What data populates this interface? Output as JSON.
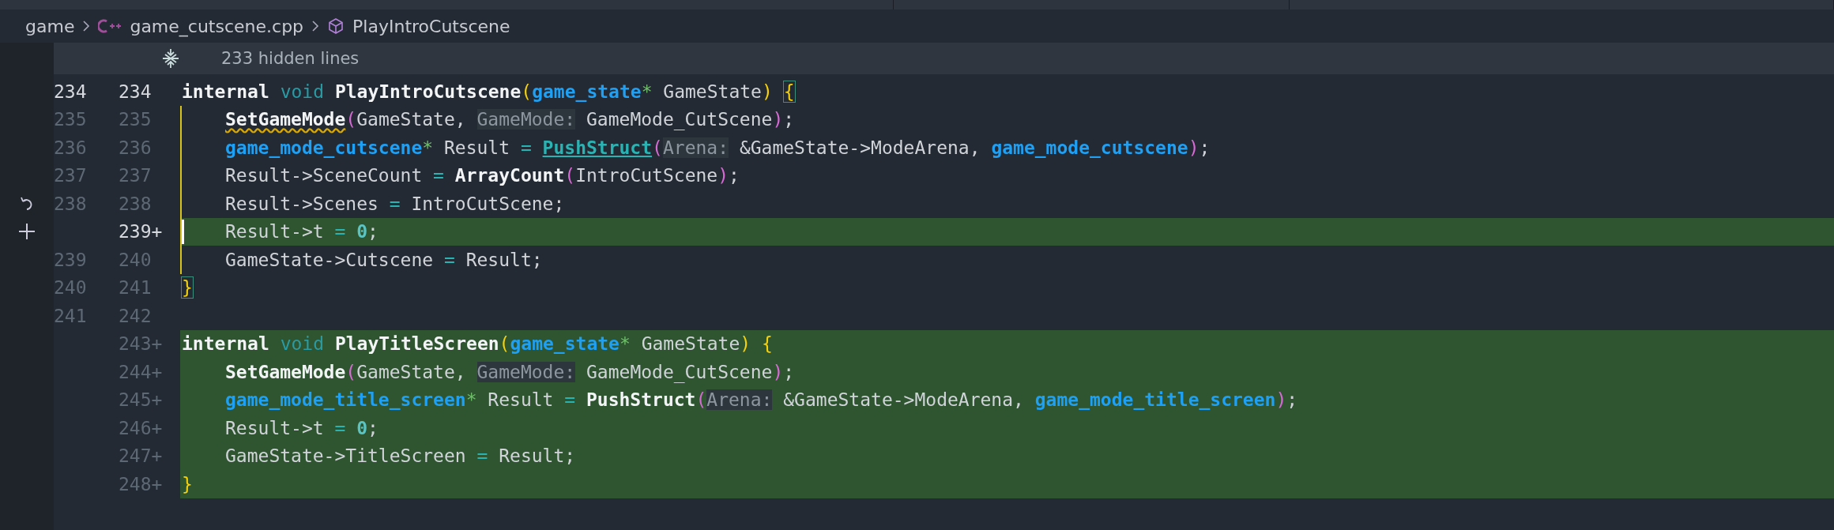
{
  "breadcrumb": [
    {
      "kind": "folder",
      "label": "game"
    },
    {
      "kind": "cpp",
      "label": "game_cutscene.cpp"
    },
    {
      "kind": "symbol",
      "label": "PlayIntroCutscene"
    }
  ],
  "folded": {
    "label": "233 hidden lines"
  },
  "lines": [
    {
      "old": "234",
      "new": "234",
      "added": false,
      "current": true,
      "scope": false,
      "cursor": false,
      "indented": false,
      "tokens": [
        {
          "kind": "kw",
          "t": "internal "
        },
        {
          "kind": "type",
          "t": "void "
        },
        {
          "kind": "fn",
          "t": "PlayIntroCutscene"
        },
        {
          "kind": "p1",
          "t": "("
        },
        {
          "kind": "tname",
          "t": "game_state"
        },
        {
          "kind": "star",
          "t": "*"
        },
        {
          "kind": "text",
          "t": " GameState"
        },
        {
          "kind": "p1",
          "t": ") "
        },
        {
          "kind": "match",
          "t": "{"
        }
      ]
    },
    {
      "old": "235",
      "new": "235",
      "added": false,
      "current": false,
      "scope": true,
      "cursor": false,
      "indented": true,
      "tokens": [
        {
          "kind": "fnwarn",
          "t": "SetGameMode"
        },
        {
          "kind": "p2",
          "t": "("
        },
        {
          "kind": "text",
          "t": "GameState, "
        },
        {
          "kind": "hint",
          "t": "GameMode:"
        },
        {
          "kind": "text",
          "t": " GameMode_CutScene"
        },
        {
          "kind": "p2",
          "t": ")"
        },
        {
          "kind": "text",
          "t": ";"
        }
      ]
    },
    {
      "old": "236",
      "new": "236",
      "added": false,
      "current": false,
      "scope": true,
      "cursor": false,
      "indented": true,
      "tokens": [
        {
          "kind": "tname",
          "t": "game_mode_cutscene"
        },
        {
          "kind": "star",
          "t": "*"
        },
        {
          "kind": "text",
          "t": " Result "
        },
        {
          "kind": "op",
          "t": "= "
        },
        {
          "kind": "fnlink",
          "t": "PushStruct"
        },
        {
          "kind": "p2",
          "t": "("
        },
        {
          "kind": "hint",
          "t": "Arena:"
        },
        {
          "kind": "text",
          "t": " &GameState->ModeArena, "
        },
        {
          "kind": "tname",
          "t": "game_mode_cutscene"
        },
        {
          "kind": "p2",
          "t": ")"
        },
        {
          "kind": "text",
          "t": ";"
        }
      ]
    },
    {
      "old": "237",
      "new": "237",
      "added": false,
      "current": false,
      "scope": true,
      "cursor": false,
      "indented": true,
      "tokens": [
        {
          "kind": "text",
          "t": "Result->SceneCount "
        },
        {
          "kind": "op",
          "t": "= "
        },
        {
          "kind": "fn",
          "t": "ArrayCount"
        },
        {
          "kind": "p2",
          "t": "("
        },
        {
          "kind": "text",
          "t": "IntroCutScene"
        },
        {
          "kind": "p2",
          "t": ")"
        },
        {
          "kind": "text",
          "t": ";"
        }
      ]
    },
    {
      "old": "238",
      "new": "238",
      "added": false,
      "current": false,
      "scope": true,
      "cursor": false,
      "indented": true,
      "tokens": [
        {
          "kind": "text",
          "t": "Result->Scenes "
        },
        {
          "kind": "op",
          "t": "="
        },
        {
          "kind": "text",
          "t": " IntroCutScene;"
        }
      ]
    },
    {
      "new": "239+",
      "added": true,
      "current": true,
      "scope": true,
      "cursor": true,
      "indented": true,
      "tokens": [
        {
          "kind": "text",
          "t": "Result->t "
        },
        {
          "kind": "op",
          "t": "= "
        },
        {
          "kind": "num",
          "t": "0"
        },
        {
          "kind": "text",
          "t": ";"
        }
      ]
    },
    {
      "old": "239",
      "new": "240",
      "added": false,
      "current": false,
      "scope": true,
      "cursor": false,
      "indented": true,
      "tokens": [
        {
          "kind": "text",
          "t": "GameState->Cutscene "
        },
        {
          "kind": "op",
          "t": "="
        },
        {
          "kind": "text",
          "t": " Result;"
        }
      ]
    },
    {
      "old": "240",
      "new": "241",
      "added": false,
      "current": false,
      "scope": false,
      "cursor": false,
      "indented": false,
      "tokens": [
        {
          "kind": "match",
          "t": "}"
        }
      ]
    },
    {
      "old": "241",
      "new": "242",
      "added": false,
      "current": false,
      "scope": false,
      "cursor": false
    },
    {
      "new": "243+",
      "added": true,
      "current": false,
      "scope": false,
      "cursor": false,
      "indented": false,
      "tokens": [
        {
          "kind": "kw",
          "t": "internal "
        },
        {
          "kind": "type",
          "t": "void "
        },
        {
          "kind": "fn",
          "t": "PlayTitleScreen"
        },
        {
          "kind": "p1",
          "t": "("
        },
        {
          "kind": "tname",
          "t": "game_state"
        },
        {
          "kind": "star",
          "t": "*"
        },
        {
          "kind": "text",
          "t": " GameState"
        },
        {
          "kind": "p1",
          "t": ") "
        },
        {
          "kind": "p1",
          "t": "{"
        }
      ]
    },
    {
      "new": "244+",
      "added": true,
      "current": false,
      "scope": false,
      "cursor": false,
      "indented": true,
      "tokens": [
        {
          "kind": "fn",
          "t": "SetGameMode"
        },
        {
          "kind": "p2",
          "t": "("
        },
        {
          "kind": "text",
          "t": "GameState, "
        },
        {
          "kind": "hint",
          "t": "GameMode:"
        },
        {
          "kind": "text",
          "t": " GameMode_CutScene"
        },
        {
          "kind": "p2",
          "t": ")"
        },
        {
          "kind": "text",
          "t": ";"
        }
      ]
    },
    {
      "new": "245+",
      "added": true,
      "current": false,
      "scope": false,
      "cursor": false,
      "indented": true,
      "tokens": [
        {
          "kind": "tname",
          "t": "game_mode_title_screen"
        },
        {
          "kind": "star",
          "t": "*"
        },
        {
          "kind": "text",
          "t": " Result "
        },
        {
          "kind": "op",
          "t": "= "
        },
        {
          "kind": "fn",
          "t": "PushStruct"
        },
        {
          "kind": "p2",
          "t": "("
        },
        {
          "kind": "hint",
          "t": "Arena:"
        },
        {
          "kind": "text",
          "t": " &GameState->ModeArena, "
        },
        {
          "kind": "tname",
          "t": "game_mode_title_screen"
        },
        {
          "kind": "p2",
          "t": ")"
        },
        {
          "kind": "text",
          "t": ";"
        }
      ]
    },
    {
      "new": "246+",
      "added": true,
      "current": false,
      "scope": false,
      "cursor": false,
      "indented": true,
      "tokens": [
        {
          "kind": "text",
          "t": "Result->t "
        },
        {
          "kind": "op",
          "t": "= "
        },
        {
          "kind": "num",
          "t": "0"
        },
        {
          "kind": "text",
          "t": ";"
        }
      ]
    },
    {
      "new": "247+",
      "added": true,
      "current": false,
      "scope": false,
      "cursor": false,
      "indented": true,
      "tokens": [
        {
          "kind": "text",
          "t": "GameState->TitleScreen "
        },
        {
          "kind": "op",
          "t": "="
        },
        {
          "kind": "text",
          "t": " Result;"
        }
      ]
    },
    {
      "new": "248+",
      "added": true,
      "current": false,
      "scope": false,
      "cursor": false,
      "indented": false,
      "tokens": [
        {
          "kind": "p1",
          "t": "}"
        }
      ]
    }
  ]
}
